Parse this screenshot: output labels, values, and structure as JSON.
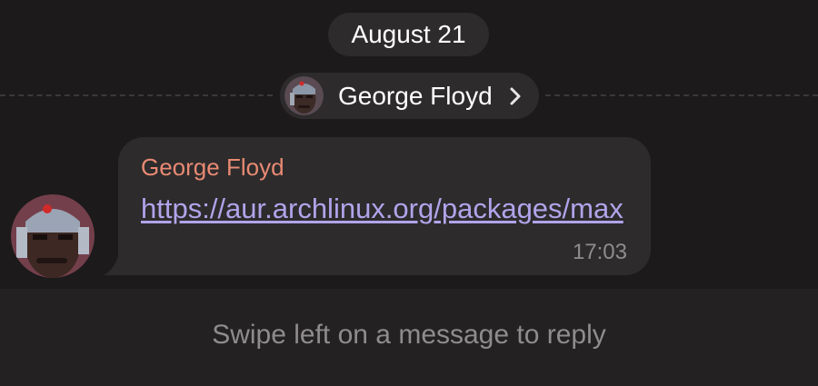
{
  "date_separator": {
    "label": "August 21"
  },
  "sender_header": {
    "name": "George Floyd",
    "avatar_icon": "user-avatar-icon",
    "chevron_icon": "chevron-right-icon"
  },
  "message": {
    "sender": "George Floyd",
    "link_text": "https://aur.archlinux.org/packages/max",
    "time": "17:03",
    "avatar_icon": "user-avatar-icon"
  },
  "footer": {
    "hint": "Swipe left on a message to reply"
  },
  "colors": {
    "background": "#1c1a1b",
    "bubble": "#2d2b2c",
    "sender_name": "#e88a73",
    "link": "#b1a4ea",
    "muted_text": "#8f8c8d",
    "footer_bg": "#232122"
  }
}
